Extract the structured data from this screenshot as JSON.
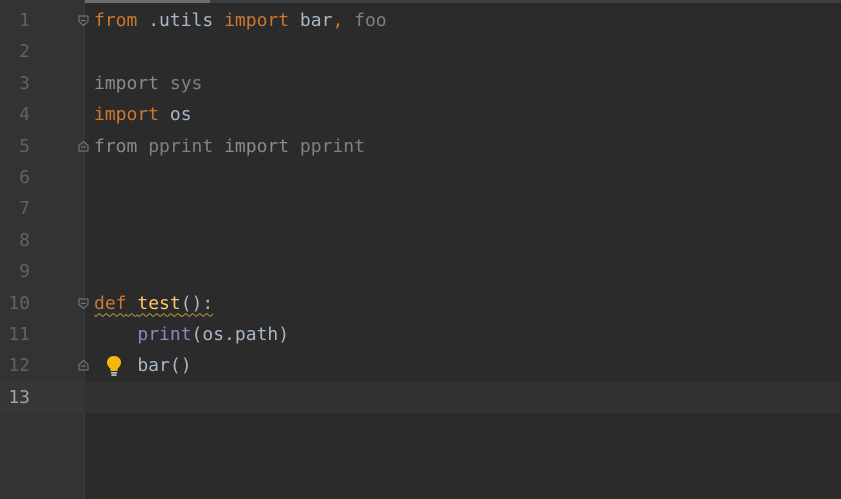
{
  "editor": {
    "current_line": 13,
    "lines": [
      {
        "num": "1",
        "tokens": [
          {
            "t": "from",
            "c": "kw"
          },
          {
            "t": " .utils ",
            "c": "pn"
          },
          {
            "t": "import",
            "c": "kw"
          },
          {
            "t": " bar",
            "c": "pn"
          },
          {
            "t": ",",
            "c": "kw"
          },
          {
            "t": " foo",
            "c": "dim"
          }
        ],
        "fold": "open"
      },
      {
        "num": "2",
        "tokens": []
      },
      {
        "num": "3",
        "tokens": [
          {
            "t": "import",
            "c": "dimkw"
          },
          {
            "t": " sys",
            "c": "dim"
          }
        ]
      },
      {
        "num": "4",
        "tokens": [
          {
            "t": "import",
            "c": "kw"
          },
          {
            "t": " os",
            "c": "pn"
          }
        ]
      },
      {
        "num": "5",
        "tokens": [
          {
            "t": "from",
            "c": "dimkw"
          },
          {
            "t": " pprint ",
            "c": "dim"
          },
          {
            "t": "import",
            "c": "dimkw"
          },
          {
            "t": " pprint",
            "c": "dim"
          }
        ],
        "fold": "close"
      },
      {
        "num": "6",
        "tokens": []
      },
      {
        "num": "7",
        "tokens": []
      },
      {
        "num": "8",
        "tokens": []
      },
      {
        "num": "9",
        "tokens": []
      },
      {
        "num": "10",
        "tokens": [
          {
            "t": "def",
            "c": "kw squiggle"
          },
          {
            "t": " ",
            "c": "pn squiggle"
          },
          {
            "t": "test",
            "c": "fn squiggle"
          },
          {
            "t": "():",
            "c": "pn squiggle"
          }
        ],
        "fold": "open"
      },
      {
        "num": "11",
        "tokens": [
          {
            "t": "    ",
            "c": "pn"
          },
          {
            "t": "print",
            "c": "bi"
          },
          {
            "t": "(os.path)",
            "c": "pn"
          }
        ]
      },
      {
        "num": "12",
        "tokens": [
          {
            "t": "    bar()",
            "c": "pn"
          }
        ],
        "fold": "close",
        "bulb": true
      },
      {
        "num": "13",
        "tokens": []
      }
    ]
  },
  "icons": {
    "bulb": "lightbulb-icon",
    "fold_open": "fold-open-icon",
    "fold_close": "fold-close-icon"
  },
  "colors": {
    "background": "#2b2b2b",
    "gutter": "#313335",
    "keyword": "#cc7832",
    "function": "#ffc66d",
    "builtin": "#8888c6",
    "plain": "#a9b7c6",
    "unused": "#808080",
    "bulb": "#f5b60d"
  }
}
